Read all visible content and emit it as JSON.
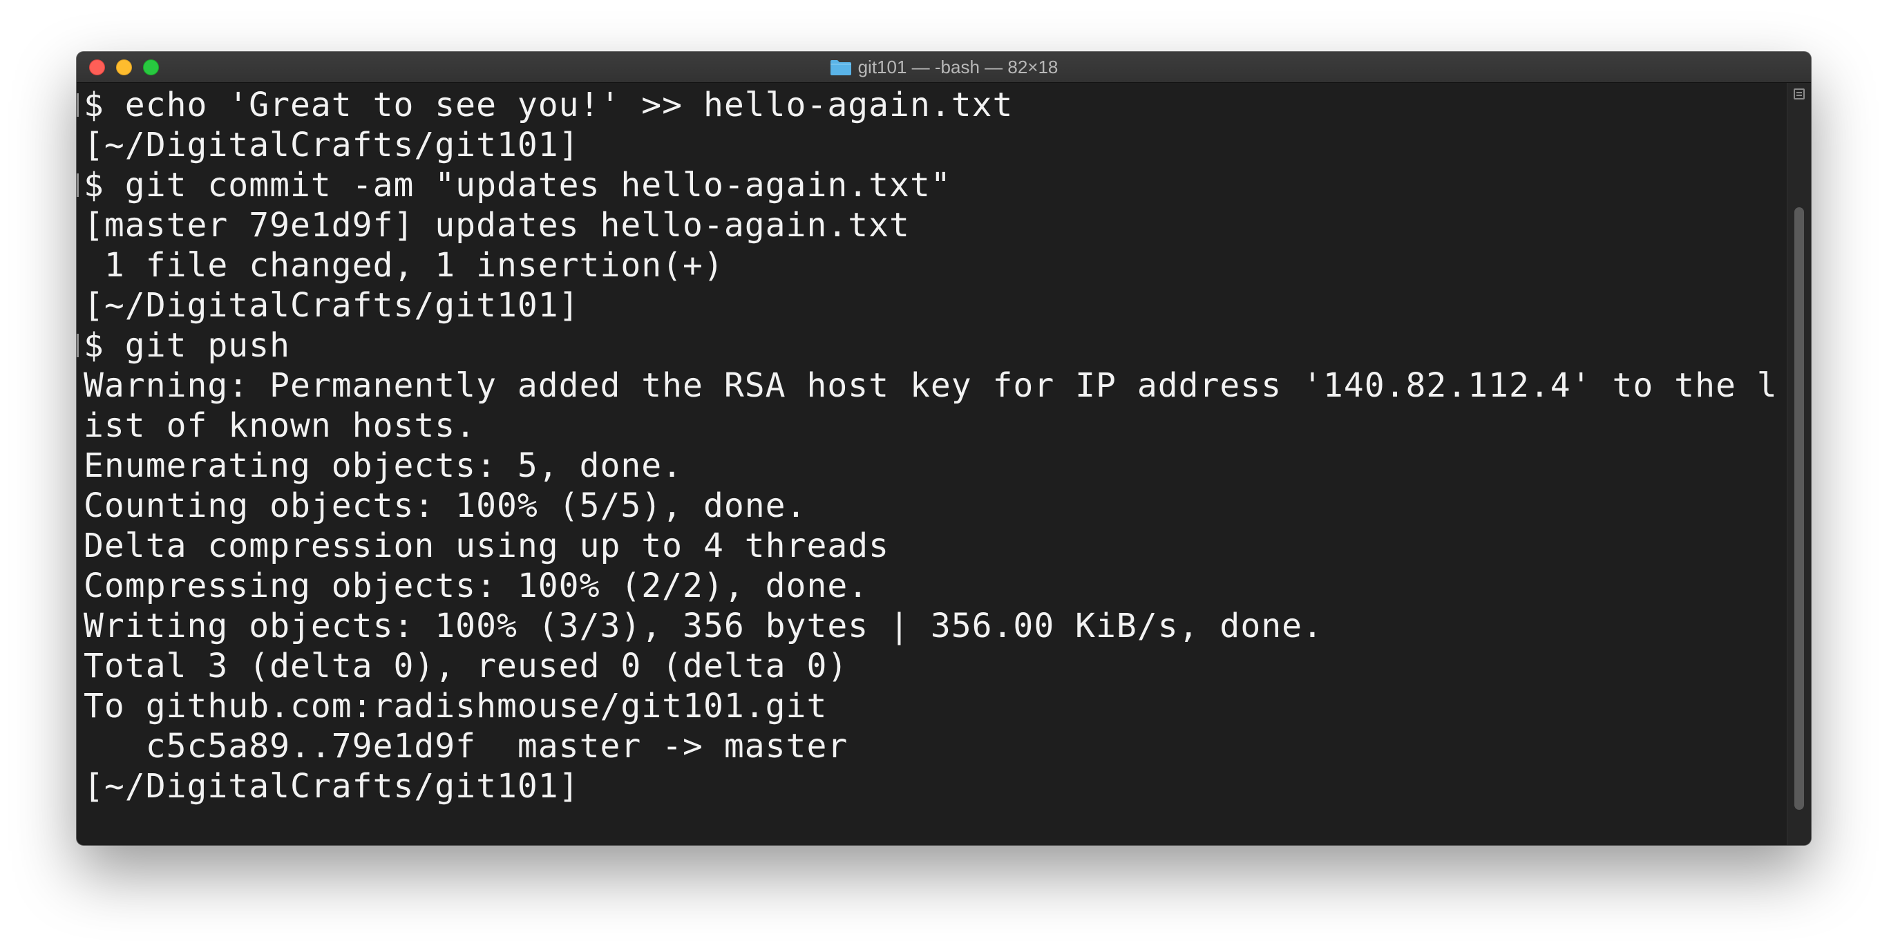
{
  "window": {
    "title": "git101 — -bash — 82×18",
    "colors": {
      "background": "#1e1e1e",
      "text": "#f2f2f2",
      "close": "#fe5f57",
      "minimize": "#febc2e",
      "zoom": "#28c840",
      "folder": "#5ab4e8"
    }
  },
  "terminal": {
    "lines": [
      "$ echo 'Great to see you!' >> hello-again.txt",
      "[~/DigitalCrafts/git101]",
      "$ git commit -am \"updates hello-again.txt\"",
      "[master 79e1d9f] updates hello-again.txt",
      " 1 file changed, 1 insertion(+)",
      "[~/DigitalCrafts/git101]",
      "$ git push",
      "Warning: Permanently added the RSA host key for IP address '140.82.112.4' to the l",
      "ist of known hosts.",
      "Enumerating objects: 5, done.",
      "Counting objects: 100% (5/5), done.",
      "Delta compression using up to 4 threads",
      "Compressing objects: 100% (2/2), done.",
      "Writing objects: 100% (3/3), 356 bytes | 356.00 KiB/s, done.",
      "Total 3 (delta 0), reused 0 (delta 0)",
      "To github.com:radishmouse/git101.git",
      "   c5c5a89..79e1d9f  master -> master",
      "[~/DigitalCrafts/git101]"
    ]
  },
  "icons": {
    "folder": "folder-icon",
    "scrollbar_menu": "list-icon"
  }
}
